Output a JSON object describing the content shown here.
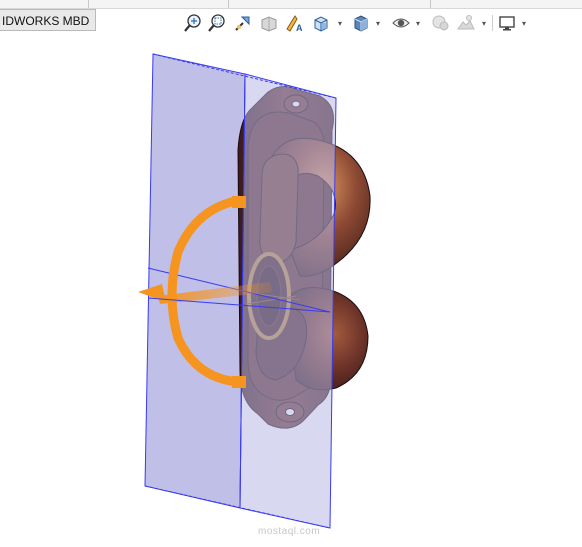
{
  "tab": {
    "label": "IDWORKS MBD"
  },
  "toolbar": {
    "icons": [
      "zoom-to-fit-icon",
      "zoom-to-area-icon",
      "previous-view-icon",
      "section-view-icon",
      "dynamic-annotation-icon",
      "view-orientation-icon",
      "display-style-icon",
      "hide-show-items-icon",
      "edit-appearance-icon",
      "apply-scene-icon",
      "view-settings-icon"
    ]
  },
  "colors": {
    "plane_fill": "#b8b8e6",
    "plane_edge": "#3a3af0",
    "part_body": "#5e3028",
    "part_highlight": "#b06a4a",
    "triad_orange": "#f5941e",
    "ring": "#b7873c"
  },
  "watermark": "mostaql.com"
}
